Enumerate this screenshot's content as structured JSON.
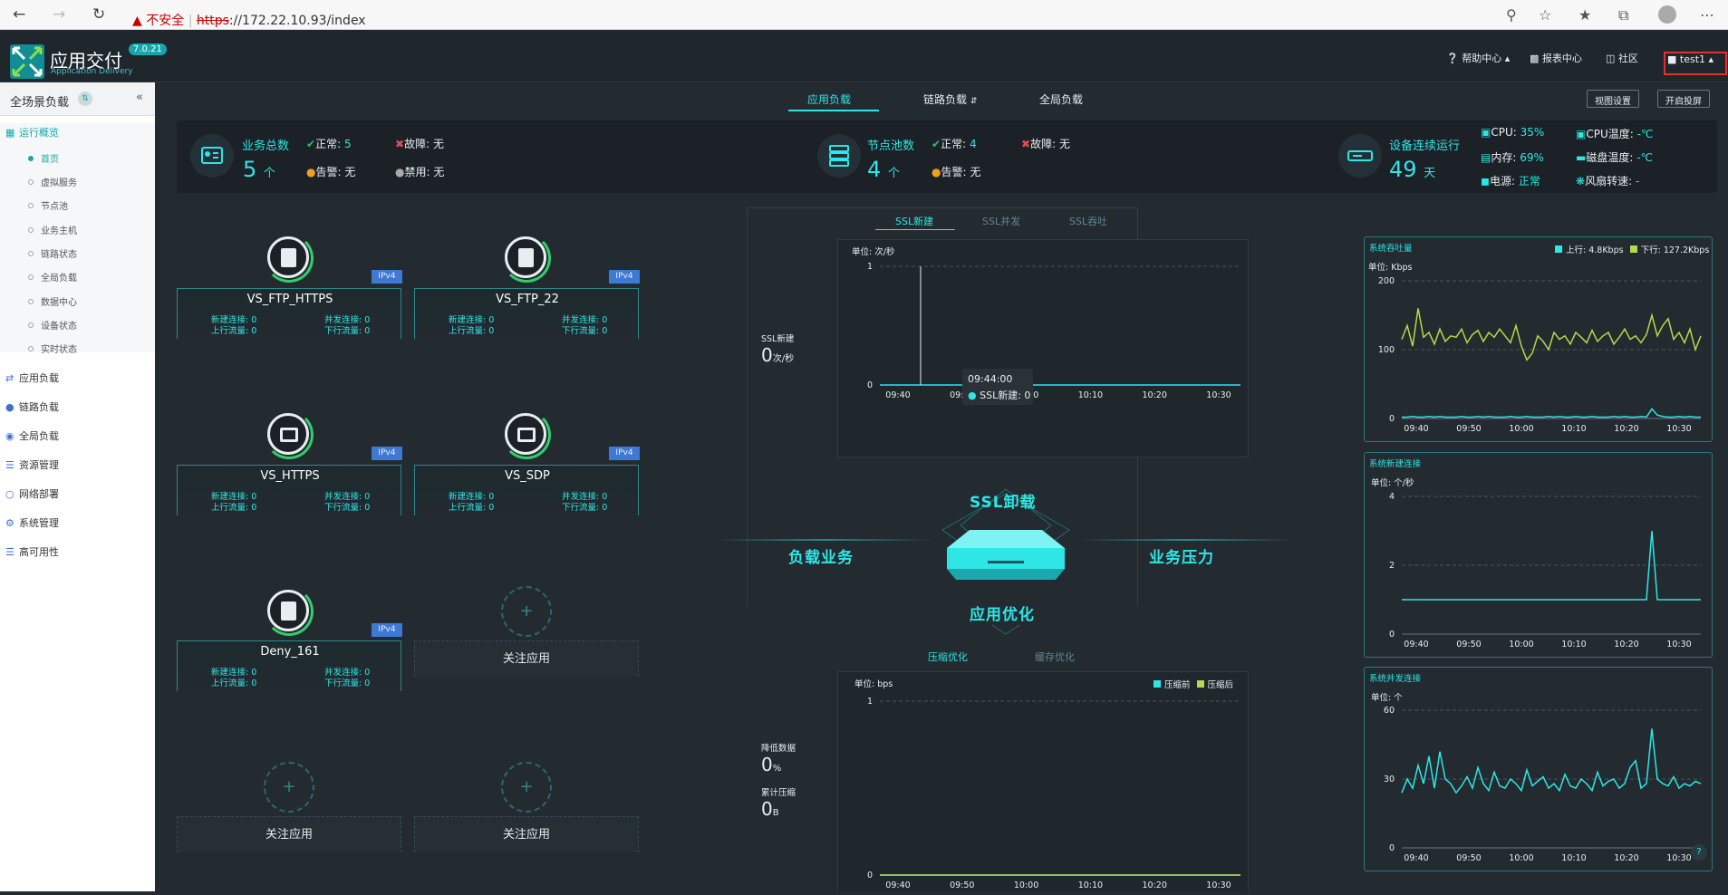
{
  "browser": {
    "not_secure": "不安全",
    "url_scheme": "https",
    "url_rest": "://172.22.10.93/index"
  },
  "app": {
    "brand": "应用交付",
    "brand_sub": "Application Delivery",
    "version": "7.0.21",
    "help": "帮助中心",
    "reports": "报表中心",
    "community": "社区",
    "user": "test1"
  },
  "sidebar": {
    "title": "全场景负载",
    "groups": [
      {
        "label": "运行概览",
        "icon": "dashboard-icon"
      },
      {
        "label": "应用负载",
        "icon": "shuffle-icon"
      },
      {
        "label": "链路负载",
        "icon": "link-icon"
      },
      {
        "label": "全局负载",
        "icon": "globe-icon"
      },
      {
        "label": "资源管理",
        "icon": "layers-icon"
      },
      {
        "label": "网络部署",
        "icon": "network-icon"
      },
      {
        "label": "系统管理",
        "icon": "gear-icon"
      },
      {
        "label": "高可用性",
        "icon": "list-icon"
      }
    ],
    "sub_items": [
      "首页",
      "虚拟服务",
      "节点池",
      "业务主机",
      "链路状态",
      "全局负载",
      "数据中心",
      "设备状态",
      "实时状态"
    ]
  },
  "tabs": [
    "应用负载",
    "链路负载",
    "全局负载"
  ],
  "buttons": {
    "view_settings": "视图设置",
    "fullscreen": "开启投屏"
  },
  "stats": {
    "biz": {
      "label": "业务总数",
      "count": "5",
      "unit": "个",
      "normal_label": "正常:",
      "normal": "5",
      "fault_label": "故障:",
      "fault": "无",
      "alarm_label": "告警:",
      "alarm": "无",
      "disabled_label": "禁用:",
      "disabled": "无"
    },
    "pool": {
      "label": "节点池数",
      "count": "4",
      "unit": "个",
      "normal_label": "正常:",
      "normal": "4",
      "fault_label": "故障:",
      "fault": "无",
      "alarm_label": "告警:",
      "alarm": "无"
    },
    "device": {
      "label": "设备连续运行",
      "days": "49",
      "unit": "天",
      "cpu_label": "CPU:",
      "cpu": "35%",
      "cpu_temp_label": "CPU温度:",
      "cpu_temp": "-℃",
      "mem_label": "内存:",
      "mem": "69%",
      "disk_temp_label": "磁盘温度:",
      "disk_temp": "-℃",
      "power_label": "电源:",
      "power": "正常",
      "fan_label": "风扇转速:",
      "fan": "-"
    }
  },
  "vs_labels": {
    "new_conn": "新建连接:",
    "concurrent": "并发连接:",
    "up": "上行流量:",
    "down": "下行流量:",
    "ipv": "IPv4"
  },
  "vs": [
    {
      "name": "VS_FTP_HTTPS",
      "new_conn": "0",
      "concurrent": "0",
      "up": "0",
      "down": "0"
    },
    {
      "name": "VS_FTP_22",
      "new_conn": "0",
      "concurrent": "0",
      "up": "0",
      "down": "0"
    },
    {
      "name": "VS_HTTPS",
      "new_conn": "0",
      "concurrent": "0",
      "up": "0",
      "down": "0"
    },
    {
      "name": "VS_SDP",
      "new_conn": "0",
      "concurrent": "0",
      "up": "0",
      "down": "0"
    },
    {
      "name": "Deny_161",
      "new_conn": "0",
      "concurrent": "0",
      "up": "0",
      "down": "0"
    }
  ],
  "follow_label": "关注应用",
  "center": {
    "ssl_tabs": [
      "SSL新建",
      "SSL并发",
      "SSL吞吐"
    ],
    "ssl_side_label": "SSL新建",
    "ssl_side_value": "0",
    "ssl_side_unit": "次/秒",
    "ssl_unit": "单位: 次/秒",
    "tooltip_time": "09:44:00",
    "tooltip_label": "SSL新建: 0",
    "words": {
      "ssl": "SSL卸载",
      "load": "负载业务",
      "pressure": "业务压力",
      "opt": "应用优化"
    },
    "opt_tabs": [
      "压缩优化",
      "缓存优化"
    ],
    "reduce_label": "降低数据",
    "reduce_value": "0",
    "reduce_unit": "%",
    "total_label": "累计压缩",
    "total_value": "0",
    "total_unit": "B",
    "opt_unit": "单位: bps",
    "opt_legend": [
      "压缩前",
      "压缩后"
    ]
  },
  "chart_data": [
    {
      "type": "line",
      "title": "",
      "ylabel": "单位: 次/秒",
      "x": [
        "09:40",
        "09:50",
        "10:00",
        "10:10",
        "10:20",
        "10:30"
      ],
      "ylim": [
        0,
        1
      ],
      "yticks": [
        0,
        1
      ],
      "series": [
        {
          "name": "SSL新建",
          "color": "#2ee6e6",
          "values": [
            0,
            0,
            0,
            0,
            0,
            0
          ]
        }
      ]
    },
    {
      "type": "line",
      "title": "",
      "ylabel": "单位: bps",
      "x": [
        "09:40",
        "09:50",
        "10:00",
        "10:10",
        "10:20",
        "10:30"
      ],
      "ylim": [
        0,
        1
      ],
      "yticks": [
        0,
        1
      ],
      "series": [
        {
          "name": "压缩前",
          "color": "#2ee6e6",
          "values": [
            0,
            0,
            0,
            0,
            0,
            0
          ]
        },
        {
          "name": "压缩后",
          "color": "#b6d94a",
          "values": [
            0,
            0,
            0,
            0,
            0,
            0
          ]
        }
      ]
    },
    {
      "type": "line",
      "title": "系统吞吐量",
      "ylabel": "单位: Kbps",
      "x": [
        "09:40",
        "09:50",
        "10:00",
        "10:10",
        "10:20",
        "10:30"
      ],
      "ylim": [
        0,
        200
      ],
      "yticks": [
        0,
        100,
        200
      ],
      "series": [
        {
          "name": "上行: 4.8Kbps",
          "color": "#2ee6e6",
          "values": [
            2,
            2,
            3,
            2,
            2,
            3,
            2,
            3,
            2,
            2,
            2,
            3,
            2,
            2,
            3,
            2,
            3,
            2,
            2,
            2,
            3,
            2,
            2,
            3,
            2,
            2,
            2,
            3,
            2,
            3,
            2,
            2,
            3,
            2,
            2,
            3,
            2,
            2,
            2,
            3,
            2,
            3,
            2,
            2,
            3,
            2,
            14,
            5,
            3,
            2,
            2,
            3,
            2,
            3,
            2,
            2
          ]
        },
        {
          "name": "下行: 127.2Kbps",
          "color": "#b6d94a",
          "values": [
            115,
            135,
            105,
            160,
            118,
            125,
            108,
            130,
            112,
            120,
            118,
            130,
            110,
            122,
            128,
            112,
            125,
            118,
            130,
            120,
            110,
            135,
            105,
            85,
            95,
            120,
            112,
            100,
            125,
            115,
            120,
            108,
            125,
            118,
            110,
            128,
            112,
            120,
            125,
            108,
            118,
            130,
            115,
            120,
            110,
            122,
            150,
            120,
            135,
            145,
            115,
            125,
            110,
            130,
            100,
            120
          ]
        }
      ]
    },
    {
      "type": "line",
      "title": "系统新建连接",
      "ylabel": "单位: 个/秒",
      "x": [
        "09:40",
        "09:50",
        "10:00",
        "10:10",
        "10:20",
        "10:30"
      ],
      "ylim": [
        0,
        4
      ],
      "yticks": [
        0,
        2,
        4
      ],
      "series": [
        {
          "name": "新建连接",
          "color": "#2ee6e6",
          "values": [
            1,
            1,
            1,
            1,
            1,
            1,
            1,
            1,
            1,
            1,
            1,
            1,
            1,
            1,
            1,
            1,
            1,
            1,
            1,
            1,
            1,
            1,
            1,
            1,
            1,
            1,
            1,
            1,
            1,
            1,
            1,
            1,
            1,
            1,
            1,
            1,
            1,
            1,
            1,
            1,
            1,
            1,
            1,
            1,
            1,
            1,
            3,
            1,
            1,
            1,
            1,
            1,
            1,
            1,
            1,
            1
          ]
        }
      ]
    },
    {
      "type": "line",
      "title": "系统并发连接",
      "ylabel": "单位: 个",
      "x": [
        "09:40",
        "09:50",
        "10:00",
        "10:10",
        "10:20",
        "10:30"
      ],
      "ylim": [
        0,
        60
      ],
      "yticks": [
        0,
        30,
        60
      ],
      "series": [
        {
          "name": "并发连接",
          "color": "#2ee6e6",
          "values": [
            24,
            30,
            26,
            36,
            28,
            40,
            26,
            42,
            30,
            28,
            24,
            27,
            31,
            26,
            35,
            28,
            25,
            33,
            27,
            26,
            30,
            28,
            25,
            34,
            27,
            29,
            31,
            26,
            28,
            25,
            32,
            27,
            26,
            30,
            28,
            25,
            33,
            27,
            29,
            30,
            26,
            28,
            35,
            38,
            26,
            28,
            52,
            30,
            28,
            27,
            31,
            26,
            28,
            27,
            29,
            28
          ]
        }
      ]
    }
  ]
}
